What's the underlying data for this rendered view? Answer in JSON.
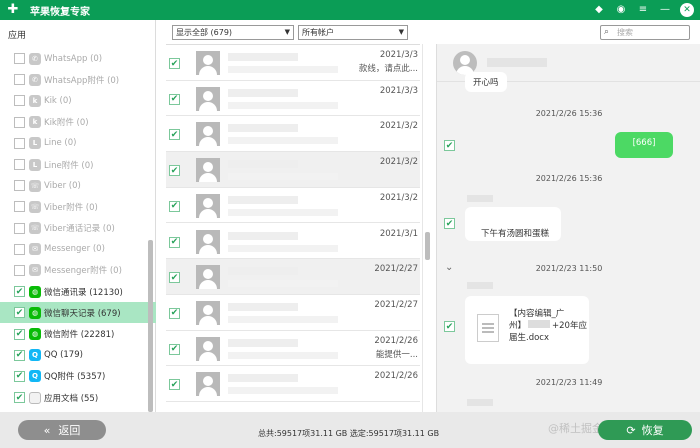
{
  "app": {
    "title": "苹果恢复专家"
  },
  "titlebar": {
    "icons": [
      "diamond-icon",
      "chat-icon",
      "menu-icon",
      "minimize-icon",
      "close-icon"
    ]
  },
  "sidebar": {
    "section_title": "应用",
    "items": [
      {
        "label": "WhatsApp (0)",
        "icon": "whatsapp-icon",
        "checked": false,
        "active": false
      },
      {
        "label": "WhatsApp附件 (0)",
        "icon": "whatsapp-icon",
        "checked": false,
        "active": false
      },
      {
        "label": "Kik (0)",
        "icon": "kik-icon",
        "checked": false,
        "active": false
      },
      {
        "label": "Kik附件 (0)",
        "icon": "kik-icon",
        "checked": false,
        "active": false
      },
      {
        "label": "Line (0)",
        "icon": "line-icon",
        "checked": false,
        "active": false
      },
      {
        "label": "Line附件 (0)",
        "icon": "line-icon",
        "checked": false,
        "active": false
      },
      {
        "label": "Viber (0)",
        "icon": "viber-icon",
        "checked": false,
        "active": false
      },
      {
        "label": "Viber附件 (0)",
        "icon": "viber-icon",
        "checked": false,
        "active": false
      },
      {
        "label": "Viber通话记录 (0)",
        "icon": "viber-icon",
        "checked": false,
        "active": false
      },
      {
        "label": "Messenger (0)",
        "icon": "messenger-icon",
        "checked": false,
        "active": false
      },
      {
        "label": "Messenger附件 (0)",
        "icon": "messenger-icon",
        "checked": false,
        "active": false
      },
      {
        "label": "微信通讯录 (12130)",
        "icon": "wechat-icon",
        "checked": true,
        "active": true
      },
      {
        "label": "微信聊天记录 (679)",
        "icon": "wechat-icon",
        "checked": true,
        "active": true,
        "selected": true
      },
      {
        "label": "微信附件 (22281)",
        "icon": "wechat-icon",
        "checked": true,
        "active": true
      },
      {
        "label": "QQ (179)",
        "icon": "qq-icon",
        "checked": true,
        "active": true
      },
      {
        "label": "QQ附件 (5357)",
        "icon": "qq-icon",
        "checked": true,
        "active": true
      },
      {
        "label": "应用文档 (55)",
        "icon": "document-icon",
        "checked": true,
        "active": true
      }
    ]
  },
  "toolbar": {
    "filter_select": "显示全部 (679)",
    "account_select": "所有帐户",
    "search_placeholder": "搜索"
  },
  "message_list": [
    {
      "date": "2021/3/3",
      "snippet": "款线，请点此...",
      "checked": true,
      "highlight": false
    },
    {
      "date": "2021/3/3",
      "snippet": "",
      "checked": true,
      "highlight": false
    },
    {
      "date": "2021/3/2",
      "snippet": "",
      "checked": true,
      "highlight": false
    },
    {
      "date": "2021/3/2",
      "snippet": "",
      "checked": true,
      "highlight": true
    },
    {
      "date": "2021/3/2",
      "snippet": "",
      "checked": true,
      "highlight": false
    },
    {
      "date": "2021/3/1",
      "snippet": "",
      "checked": true,
      "highlight": false
    },
    {
      "date": "2021/2/27",
      "snippet": "",
      "checked": true,
      "highlight": true
    },
    {
      "date": "2021/2/27",
      "snippet": "",
      "checked": true,
      "highlight": false
    },
    {
      "date": "2021/2/26",
      "snippet": "能提供一...",
      "checked": true,
      "highlight": false
    },
    {
      "date": "2021/2/26",
      "snippet": "",
      "checked": true,
      "highlight": false
    }
  ],
  "chat": {
    "top_bubble_text": "开心吗",
    "messages": [
      {
        "timestamp": "2021/2/26 15:36"
      },
      {
        "text": "[666]",
        "side": "right"
      },
      {
        "timestamp": "2021/2/26 15:36"
      },
      {
        "text": "下午有汤圆和蛋糕",
        "side": "left"
      },
      {
        "timestamp": "2021/2/23 11:50"
      },
      {
        "file_line1": "【内容编辑_广",
        "file_line2a": "州】",
        "file_line2b": "+20年应",
        "file_line3": "届生.docx",
        "side": "left"
      },
      {
        "timestamp": "2021/2/23 11:49"
      }
    ]
  },
  "bottom": {
    "back_label": "返回",
    "restore_label": "恢复",
    "status": "总共:59517项31.11 GB 选定:59517项31.11 GB",
    "watermark": "@稀土掘金技术社区"
  }
}
